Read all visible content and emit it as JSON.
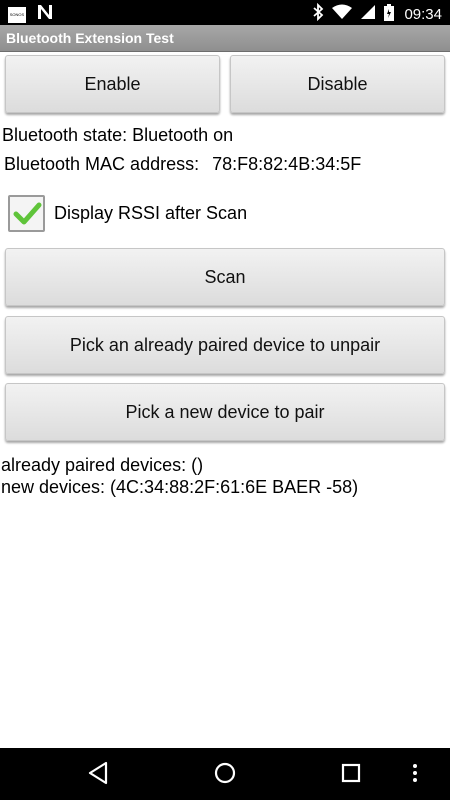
{
  "status_bar": {
    "time": "09:34",
    "left_icons": [
      "notification-box-icon",
      "n-logo-icon"
    ],
    "right_icons": [
      "bluetooth-icon",
      "wifi-icon",
      "signal-icon",
      "battery-icon"
    ],
    "notif_box_text": "SONOS"
  },
  "app": {
    "title": "Bluetooth Extension Test"
  },
  "buttons": {
    "enable": "Enable",
    "disable": "Disable",
    "scan": "Scan",
    "unpair": "Pick an already paired device to unpair",
    "pair": "Pick a new device to pair"
  },
  "info": {
    "state": "Bluetooth state: Bluetooth on",
    "mac_label": "Bluetooth MAC address:",
    "mac_value": "78:F8:82:4B:34:5F"
  },
  "checkbox": {
    "label": "Display RSSI after Scan",
    "checked": true
  },
  "results": {
    "paired": "already paired devices: ()",
    "new_devices": "new devices: (4C:34:88:2F:61:6E BAER -58)"
  },
  "nav": {
    "icons": [
      "back-icon",
      "home-icon",
      "recents-icon",
      "more-icon"
    ]
  },
  "colors": {
    "check_green": "#5fc43a",
    "title_bar": "#9b9b9b"
  }
}
